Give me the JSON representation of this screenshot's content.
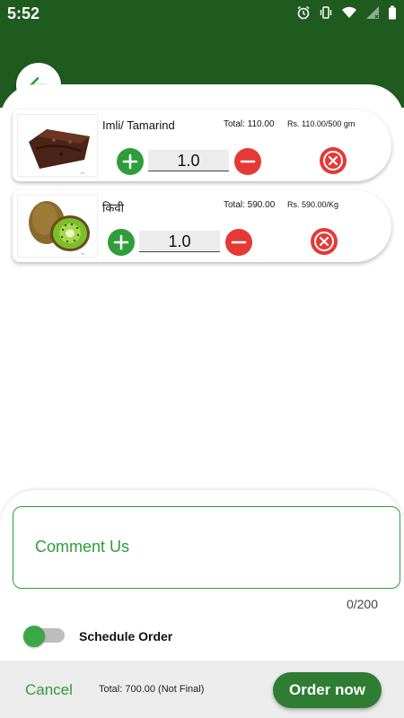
{
  "status_bar": {
    "time": "5:52",
    "icons": [
      "alarm-icon",
      "vibrate-icon",
      "wifi-icon",
      "signal-icon",
      "battery-icon"
    ]
  },
  "header": {
    "back_icon": "arrow-left-icon"
  },
  "cart": {
    "items": [
      {
        "name": "Imli/ Tamarind",
        "total": "Total: 110.00",
        "price": "Rs. 110.00/500 gm",
        "quantity": "1.0",
        "image": "tamarind-image"
      },
      {
        "name": "किवी",
        "total": "Total: 590.00",
        "price": "Rs. 590.00/Kg",
        "quantity": "1.0",
        "image": "kiwi-image"
      }
    ]
  },
  "comment": {
    "placeholder": "Comment Us",
    "counter": "0/200"
  },
  "schedule": {
    "label": "Schedule Order",
    "enabled": false
  },
  "footer": {
    "cancel_label": "Cancel",
    "total_text": "Total: 700.00 (Not Final)",
    "order_label": "Order now"
  },
  "colors": {
    "header_green": "#1f5a1f",
    "accent_green": "#2e9d3a",
    "button_green": "#2e7d32",
    "remove_red": "#e53935"
  }
}
